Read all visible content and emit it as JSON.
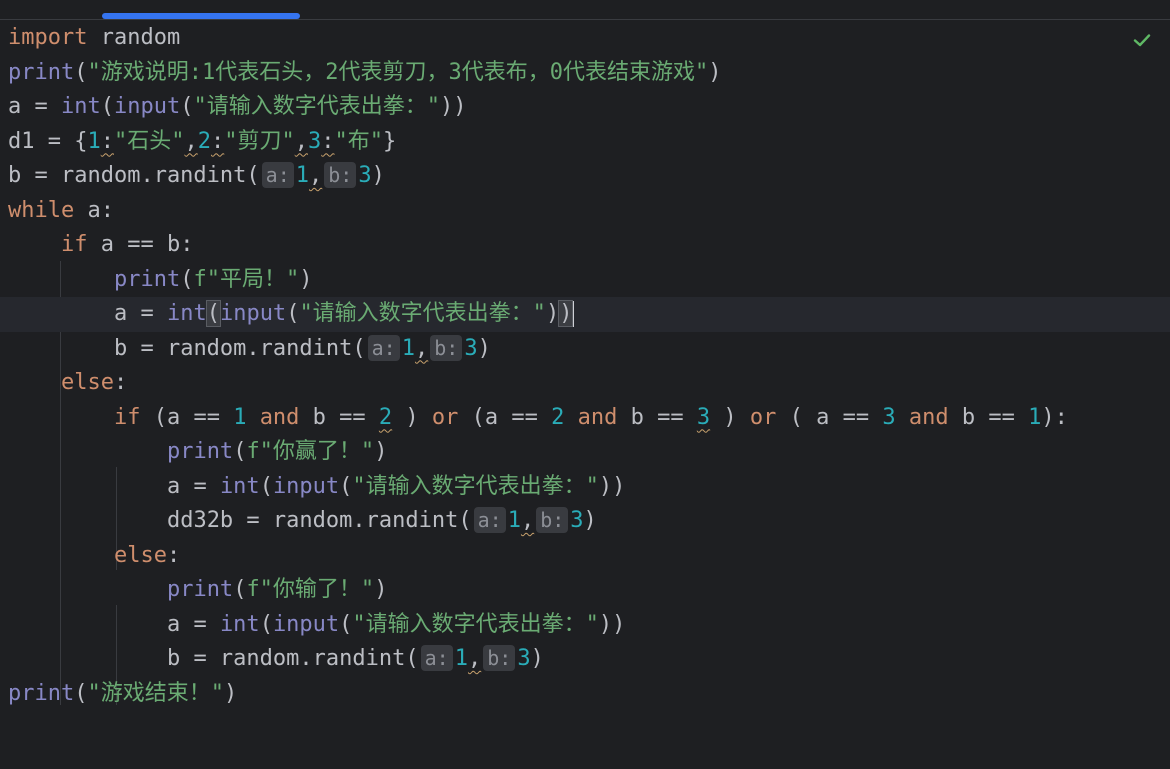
{
  "editor": {
    "status_icon": "check-icon",
    "colors": {
      "background": "#1e1f22",
      "keyword": "#cf8e6d",
      "builtin": "#8888c6",
      "string": "#6aab73",
      "number": "#2aacb8",
      "text": "#bcbec4",
      "hint_bg": "#393b40",
      "scroll_thumb": "#3574f0",
      "check": "#5fb865"
    }
  },
  "code": {
    "l1": {
      "kw": "import",
      "rest": " random"
    },
    "l2": {
      "fn": "print",
      "open": "(",
      "str": "\"游戏说明:1代表石头，2代表剪刀，3代表布，0代表结束游戏\"",
      "close": ")"
    },
    "l3": {
      "pre": "a = ",
      "fn1": "int",
      "p1": "(",
      "fn2": "input",
      "p2": "(",
      "str": "\"请输入数字代表出拳：\"",
      "close": "))"
    },
    "l4": {
      "pre": "d1 = {",
      "n1": "1",
      "c1": ":",
      "s1": "\"石头\"",
      "sep1": ",",
      "n2": "2",
      "c2": ":",
      "s2": "\"剪刀\"",
      "sep2": ",",
      "n3": "3",
      "c3": ":",
      "s3": "\"布\"",
      "close": "}"
    },
    "l5": {
      "pre": "b = random.randint(",
      "h1": "a:",
      "n1": "1",
      "sep": ",",
      "h2": "b:",
      "n2": "3",
      "close": ")"
    },
    "l6": {
      "kw": "while",
      "rest": " a:"
    },
    "l7": {
      "kw": "if",
      "rest": " a == b:"
    },
    "l8": {
      "fn": "print",
      "open": "(",
      "fstr": "f\"平局！\"",
      "close": ")"
    },
    "l9": {
      "pre": "a = ",
      "fn1": "int",
      "p1": "(",
      "fn2": "input",
      "p2": "(",
      "str": "\"请输入数字代表出拳：\"",
      "close1": ")",
      "close2": ")"
    },
    "l10": {
      "pre": "b = random.randint(",
      "h1": "a:",
      "n1": "1",
      "sep": ",",
      "h2": "b:",
      "n2": "3",
      "close": ")"
    },
    "l11": {
      "kw": "else",
      "rest": ":"
    },
    "l12": {
      "kw_if": "if",
      "t1": " (a == ",
      "n1": "1",
      "and1": "and",
      "t2": " b == ",
      "n2": "2",
      "t3": " ) ",
      "or1": "or",
      "t4": " (a == ",
      "n3": "2",
      "and2": "and",
      "t5": " b == ",
      "n4": "3",
      "t6": " ) ",
      "or2": "or",
      "t7": " ( a == ",
      "n5": "3",
      "and3": "and",
      "t8": " b == ",
      "n6": "1",
      "t9": "):"
    },
    "l13": {
      "fn": "print",
      "open": "(",
      "fstr": "f\"你赢了！\"",
      "close": ")"
    },
    "l14": {
      "pre": "a = ",
      "fn1": "int",
      "p1": "(",
      "fn2": "input",
      "p2": "(",
      "str": "\"请输入数字代表出拳：\"",
      "close": "))"
    },
    "l15": {
      "pre": "dd32b = random.randint(",
      "h1": "a:",
      "n1": "1",
      "sep": ",",
      "h2": "b:",
      "n2": "3",
      "close": ")"
    },
    "l16": {
      "kw": "else",
      "rest": ":"
    },
    "l17": {
      "fn": "print",
      "open": "(",
      "fstr": "f\"你输了！\"",
      "close": ")"
    },
    "l18": {
      "pre": "a = ",
      "fn1": "int",
      "p1": "(",
      "fn2": "input",
      "p2": "(",
      "str": "\"请输入数字代表出拳：\"",
      "close": "))"
    },
    "l19": {
      "pre": "b = random.randint(",
      "h1": "a:",
      "n1": "1",
      "sep": ",",
      "h2": "b:",
      "n2": "3",
      "close": ")"
    },
    "l20": {
      "fn": "print",
      "open": "(",
      "str": "\"游戏结束！\"",
      "close": ")"
    }
  }
}
